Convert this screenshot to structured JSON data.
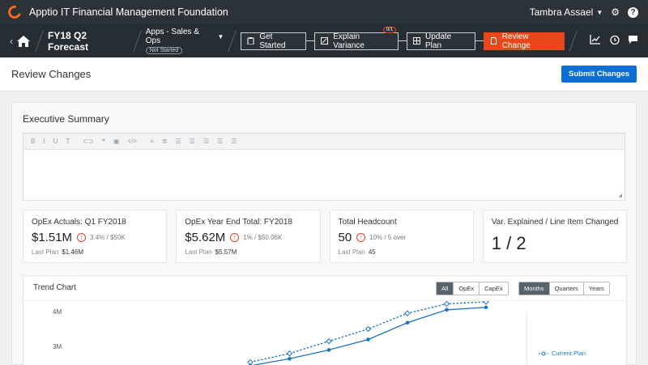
{
  "topbar": {
    "app_title": "Apptio IT Financial Management Foundation",
    "user_name": "Tambra Assael"
  },
  "navbar": {
    "forecast_name": "FY18 Q2 Forecast",
    "apps_label": "Apps - Sales & Ops",
    "status_badge": "Not Started",
    "steps": [
      {
        "label": "Get Started"
      },
      {
        "label": "Explain Variance",
        "count": "0/1"
      },
      {
        "label": "Update Plan"
      },
      {
        "label": "Review Change"
      }
    ]
  },
  "header": {
    "title": "Review Changes",
    "submit_label": "Submit Changes"
  },
  "summary": {
    "title": "Executive Summary",
    "toolbar": [
      "B",
      "I",
      "U",
      "T",
      "⊂⊃",
      "❝",
      "▣",
      "</>",
      "≡",
      "≣",
      "☰",
      "☰",
      "☰",
      "☰",
      "☰"
    ]
  },
  "cards": [
    {
      "label": "OpEx Actuals: Q1 FY2018",
      "value": "$1.51M",
      "delta": "3.4% / $50K",
      "last_label": "Last Plan",
      "last_value": "$1.46M"
    },
    {
      "label": "OpEx Year End Total: FY2018",
      "value": "$5.62M",
      "delta": "1% / $50.06K",
      "last_label": "Last Plan",
      "last_value": "$5.57M"
    },
    {
      "label": "Total Headcount",
      "value": "50",
      "delta": "10% / 5 over",
      "last_label": "Last Plan",
      "last_value": "45"
    },
    {
      "label": "Var. Explained / Line Item Changed",
      "value": "1 / 2"
    }
  ],
  "trend": {
    "title": "Trend Chart",
    "filter_options": [
      "All",
      "OpEx",
      "CapEx"
    ],
    "filter_selected": "All",
    "period_options": [
      "Months",
      "Quarters",
      "Years"
    ],
    "period_selected": "Months",
    "legend_current": "Current Plan",
    "colors": {
      "series": "#1a73c6"
    }
  },
  "chart_data": {
    "type": "line",
    "x": [
      1,
      2,
      3,
      4,
      5,
      6,
      7
    ],
    "ylim": [
      2.4,
      4.3
    ],
    "yticks": [
      {
        "v": 4,
        "label": "4M"
      },
      {
        "v": 3,
        "label": "3M"
      }
    ],
    "series": [
      {
        "name": "Current Plan",
        "style": "dashed",
        "values": [
          2.55,
          2.8,
          3.15,
          3.5,
          3.95,
          4.22,
          4.28
        ]
      },
      {
        "name": "",
        "style": "solid",
        "values": [
          2.45,
          2.65,
          2.9,
          3.2,
          3.68,
          4.05,
          4.12
        ]
      }
    ]
  }
}
